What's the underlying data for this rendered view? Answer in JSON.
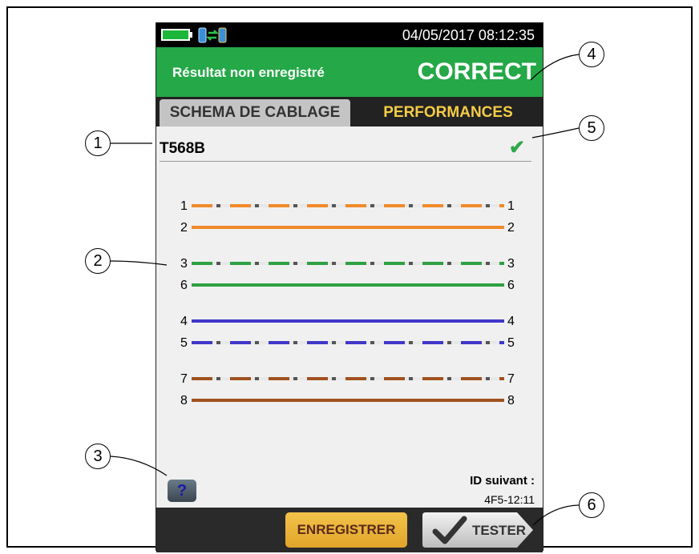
{
  "status": {
    "datetime": "04/05/2017 08:12:35"
  },
  "result": {
    "saved_state": "Résultat non enregistré",
    "verdict": "CORRECT"
  },
  "tabs": [
    {
      "label": "SCHEMA DE CABLAGE",
      "active": false
    },
    {
      "label": "PERFORMANCES",
      "active": true
    }
  ],
  "wiremap": {
    "standard": "T568B",
    "status_icon": "checkmark-icon",
    "pairs": [
      {
        "left": "1",
        "right": "1",
        "color": "#f08a2a",
        "striped": true
      },
      {
        "left": "2",
        "right": "2",
        "color": "#f08a2a",
        "striped": false
      },
      {
        "left": "3",
        "right": "3",
        "color": "#2ea043",
        "striped": true
      },
      {
        "left": "6",
        "right": "6",
        "color": "#2ea043",
        "striped": false
      },
      {
        "left": "4",
        "right": "4",
        "color": "#3f37c9",
        "striped": false
      },
      {
        "left": "5",
        "right": "5",
        "color": "#3f37c9",
        "striped": true
      },
      {
        "left": "7",
        "right": "7",
        "color": "#a0521f",
        "striped": true
      },
      {
        "left": "8",
        "right": "8",
        "color": "#a0521f",
        "striped": false
      }
    ]
  },
  "help": {
    "label": "?"
  },
  "next_id": {
    "label": "ID suivant :",
    "value": "4F5-12:11"
  },
  "buttons": {
    "save": "ENREGISTRER",
    "test": "TESTER"
  },
  "callouts": [
    "1",
    "2",
    "3",
    "4",
    "5",
    "6"
  ],
  "colors": {
    "pass_green": "#25a847",
    "tab_active_text": "#f5cc45",
    "save_button": "#f0b93a"
  }
}
